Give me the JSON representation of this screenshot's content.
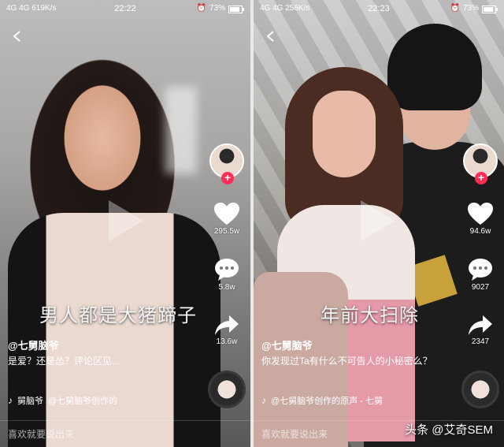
{
  "left": {
    "status": {
      "signal": "4G 4G 619K/s",
      "time": "22:22",
      "battery": "73%",
      "battery_level": 0.73
    },
    "like_count": "295.5w",
    "comment_count": "5.8w",
    "share_count": "13.6w",
    "caption": "男人都是大猪蹄子",
    "author": "@七舅脑爷",
    "description": "是爱？还是怂？评论区见...",
    "music_name": "舅脑爷",
    "music_detail": "@七舅脑爷创作的",
    "comment_placeholder": "喜欢就要说出来"
  },
  "right": {
    "status": {
      "signal": "4G 4G 256K/s",
      "time": "22:23",
      "battery": "73%",
      "battery_level": 0.73
    },
    "like_count": "94.6w",
    "comment_count": "9027",
    "share_count": "2347",
    "caption": "年前大扫除",
    "author": "@七舅脑爷",
    "description": "你发现过Ta有什么不可告人的小秘密么？",
    "music_detail": "@七舅脑爷创作的原声 - 七舅",
    "comment_placeholder": "喜欢就要说出来"
  },
  "watermark": "头条 @艾奇SEM",
  "colors": {
    "follow": "#ff2d55",
    "text": "#ffffff"
  }
}
